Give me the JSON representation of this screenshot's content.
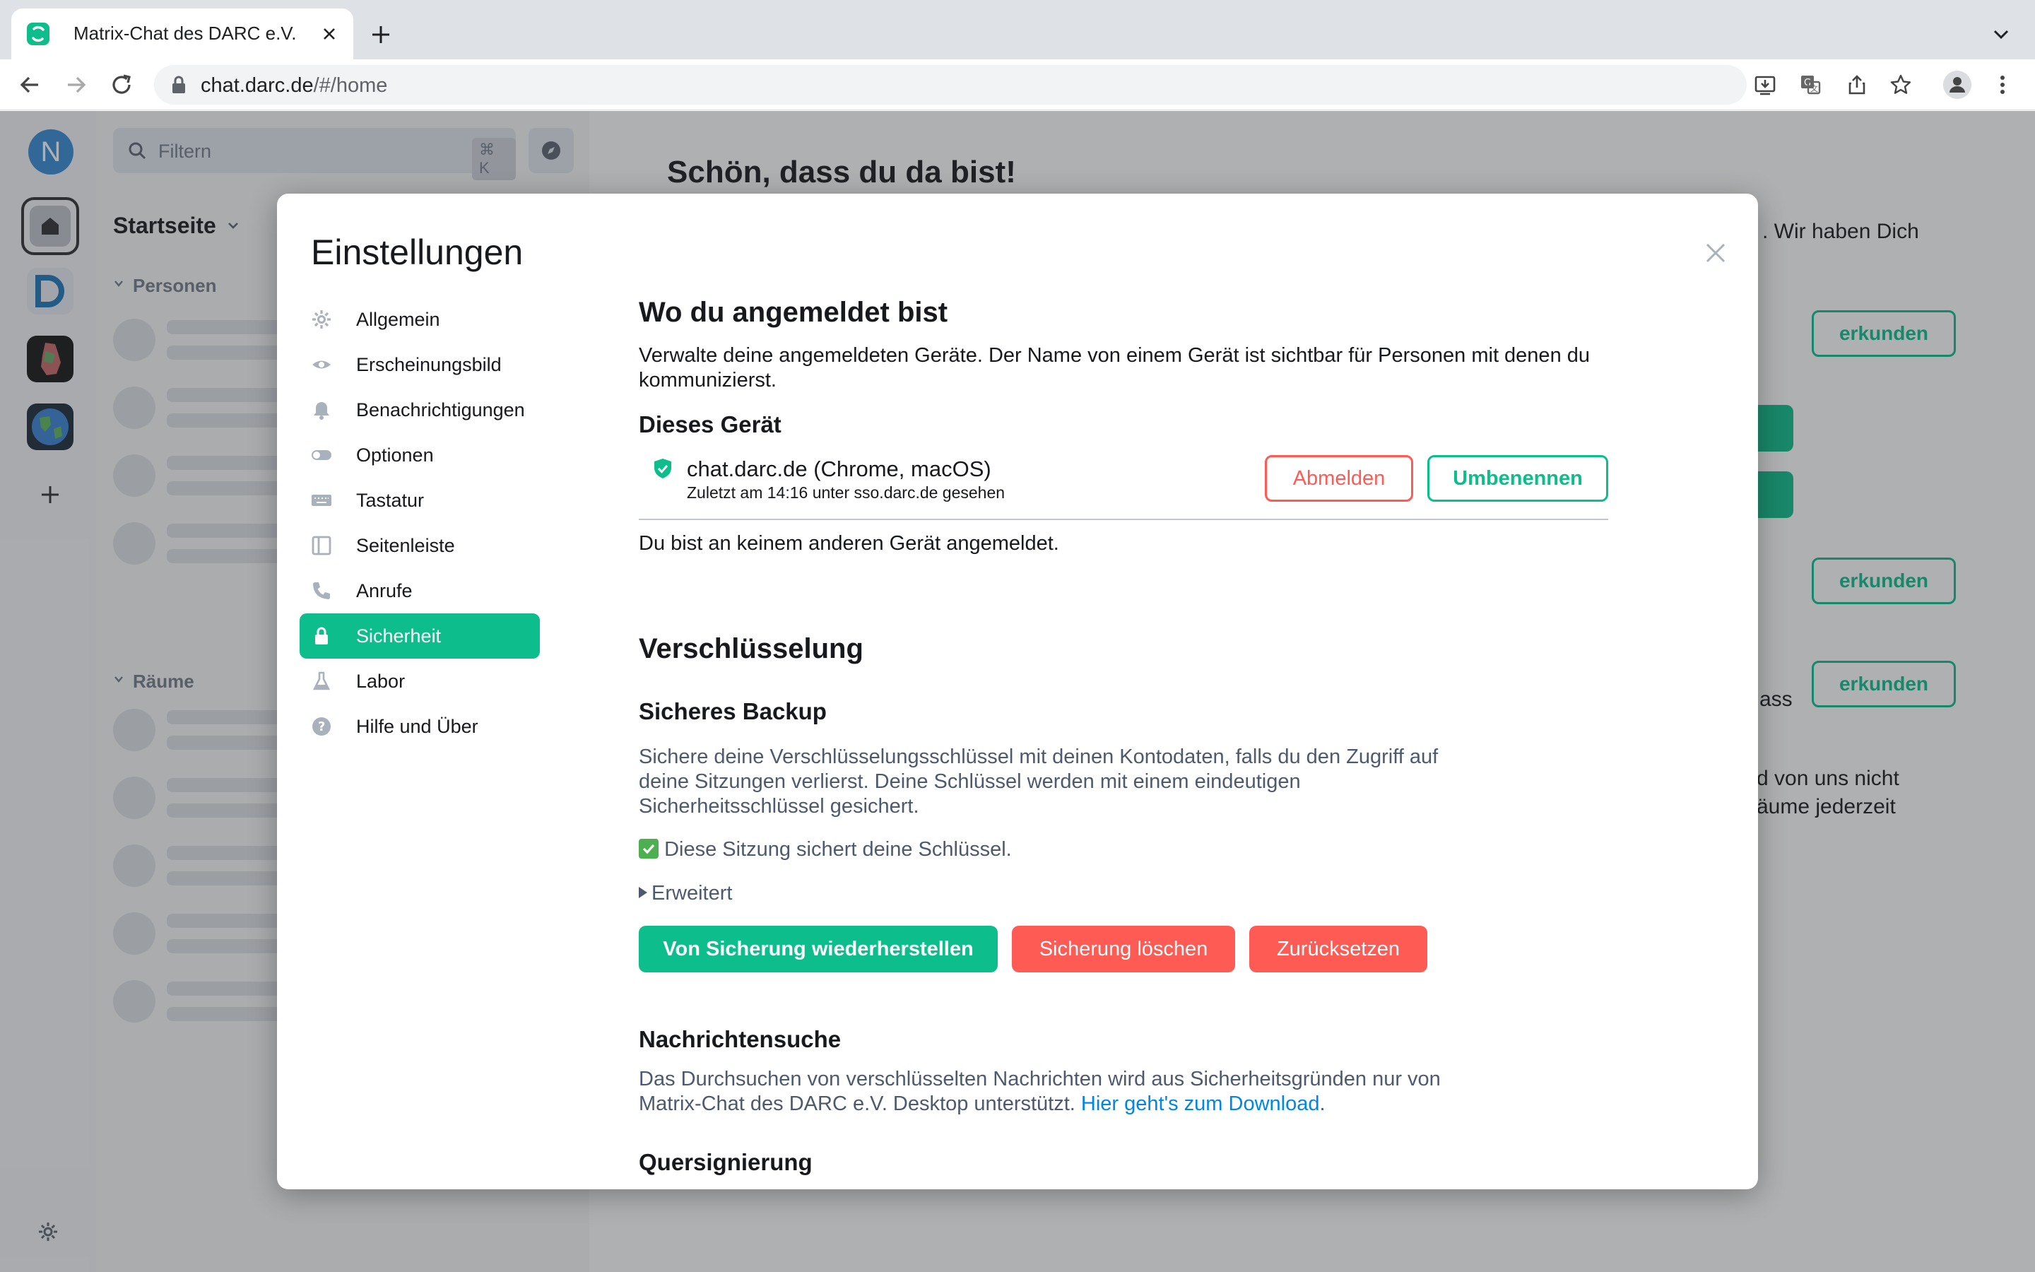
{
  "browser": {
    "tab_title": "Matrix-Chat des DARC e.V.",
    "url_domain": "chat.darc.de",
    "url_path": "/#/home"
  },
  "sidebar": {
    "avatar_initial": "N",
    "settings_icon": "gear-icon"
  },
  "roomlist": {
    "filter_placeholder": "Filtern",
    "filter_shortcut": "⌘ K",
    "home_title": "Startseite",
    "section_people": "Personen",
    "section_rooms": "Räume"
  },
  "home": {
    "welcome_title": "Schön, dass du da bist!",
    "text_fragment_1": ". Wir haben Dich",
    "explore_label": "erkunden",
    "text_fragment_2": "ass",
    "text_fragment_3": "d von uns nicht",
    "text_fragment_4": "äume jederzeit"
  },
  "settings": {
    "title": "Einstellungen",
    "nav": [
      {
        "label": "Allgemein",
        "icon": "gear-icon"
      },
      {
        "label": "Erscheinungsbild",
        "icon": "eye-icon"
      },
      {
        "label": "Benachrichtigungen",
        "icon": "bell-icon"
      },
      {
        "label": "Optionen",
        "icon": "toggle-icon"
      },
      {
        "label": "Tastatur",
        "icon": "keyboard-icon"
      },
      {
        "label": "Seitenleiste",
        "icon": "sidebar-icon"
      },
      {
        "label": "Anrufe",
        "icon": "phone-icon"
      },
      {
        "label": "Sicherheit",
        "icon": "lock-icon",
        "active": true
      },
      {
        "label": "Labor",
        "icon": "flask-icon"
      },
      {
        "label": "Hilfe und Über",
        "icon": "help-icon"
      }
    ],
    "sessions": {
      "heading": "Wo du angemeldet bist",
      "description": "Verwalte deine angemeldeten Geräte. Der Name von einem Gerät ist sichtbar für Personen mit denen du kommunizierst.",
      "this_device_heading": "Dieses Gerät",
      "device_name": "chat.darc.de (Chrome, macOS)",
      "device_meta": "Zuletzt am 14:16 unter sso.darc.de gesehen",
      "sign_out_label": "Abmelden",
      "rename_label": "Umbenennen",
      "no_other_devices": "Du bist an keinem anderen Gerät angemeldet."
    },
    "encryption": {
      "heading": "Verschlüsselung",
      "backup_heading": "Sicheres Backup",
      "backup_description": "Sichere deine Verschlüsselungsschlüssel mit deinen Kontodaten, falls du den Zugriff auf deine Sitzungen verlierst. Deine Schlüssel werden mit einem eindeutigen Sicherheitsschlüssel gesichert.",
      "backup_status": "Diese Sitzung sichert deine Schlüssel.",
      "advanced_label": "Erweitert",
      "restore_label": "Von Sicherung wiederherstellen",
      "delete_label": "Sicherung löschen",
      "reset_label": "Zurücksetzen",
      "search_heading": "Nachrichtensuche",
      "search_description": "Das Durchsuchen von verschlüsselten Nachrichten wird aus Sicherheitsgründen nur von Matrix-Chat des DARC e.V. Desktop unterstützt.",
      "download_link": "Hier geht's zum Download",
      "cross_signing_heading": "Quersignierung"
    }
  },
  "colors": {
    "accent": "#0dbd8b",
    "danger": "#ff5b55",
    "link": "#0086e6"
  }
}
